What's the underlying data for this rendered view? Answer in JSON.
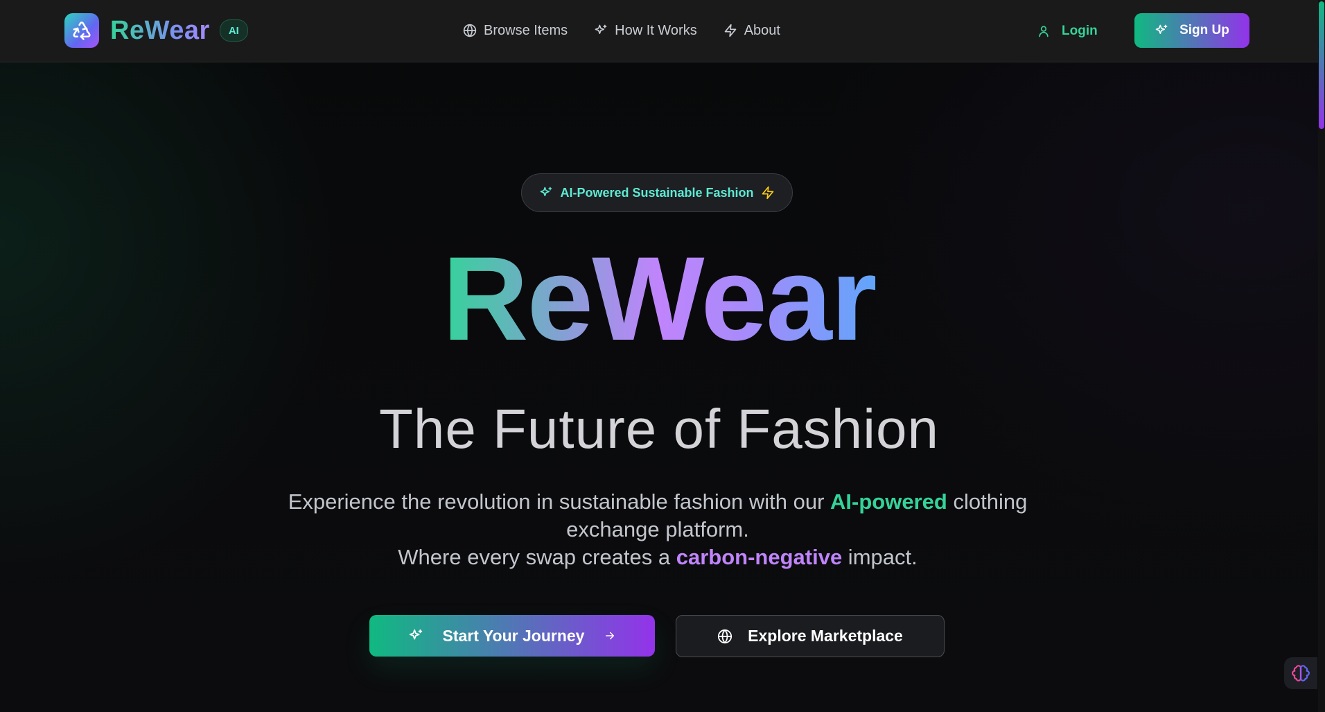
{
  "brand": {
    "name": "ReWear",
    "badge": "AI",
    "logo_icon": "recycle-icon"
  },
  "nav": {
    "items": [
      {
        "label": "Browse Items",
        "icon": "globe-icon"
      },
      {
        "label": "How It Works",
        "icon": "sparkles-icon"
      },
      {
        "label": "About",
        "icon": "zap-icon"
      }
    ],
    "login_label": "Login",
    "signup_label": "Sign Up"
  },
  "hero": {
    "pill_label": "AI-Powered Sustainable Fashion",
    "title": "ReWear",
    "subtitle": "The Future of Fashion",
    "desc_line1_a": "Experience the revolution in sustainable fashion with our ",
    "desc_line1_hl": "AI-powered",
    "desc_line1_b": " clothing exchange platform.",
    "desc_line2_a": "Where every swap creates a ",
    "desc_line2_hl": "carbon-negative",
    "desc_line2_b": " impact.",
    "primary_cta": "Start Your Journey",
    "secondary_cta": "Explore Marketplace"
  },
  "colors": {
    "accent_green": "#34d399",
    "accent_purple": "#c084fc",
    "button_gradient_start": "#10b981",
    "button_gradient_end": "#9333ea"
  }
}
